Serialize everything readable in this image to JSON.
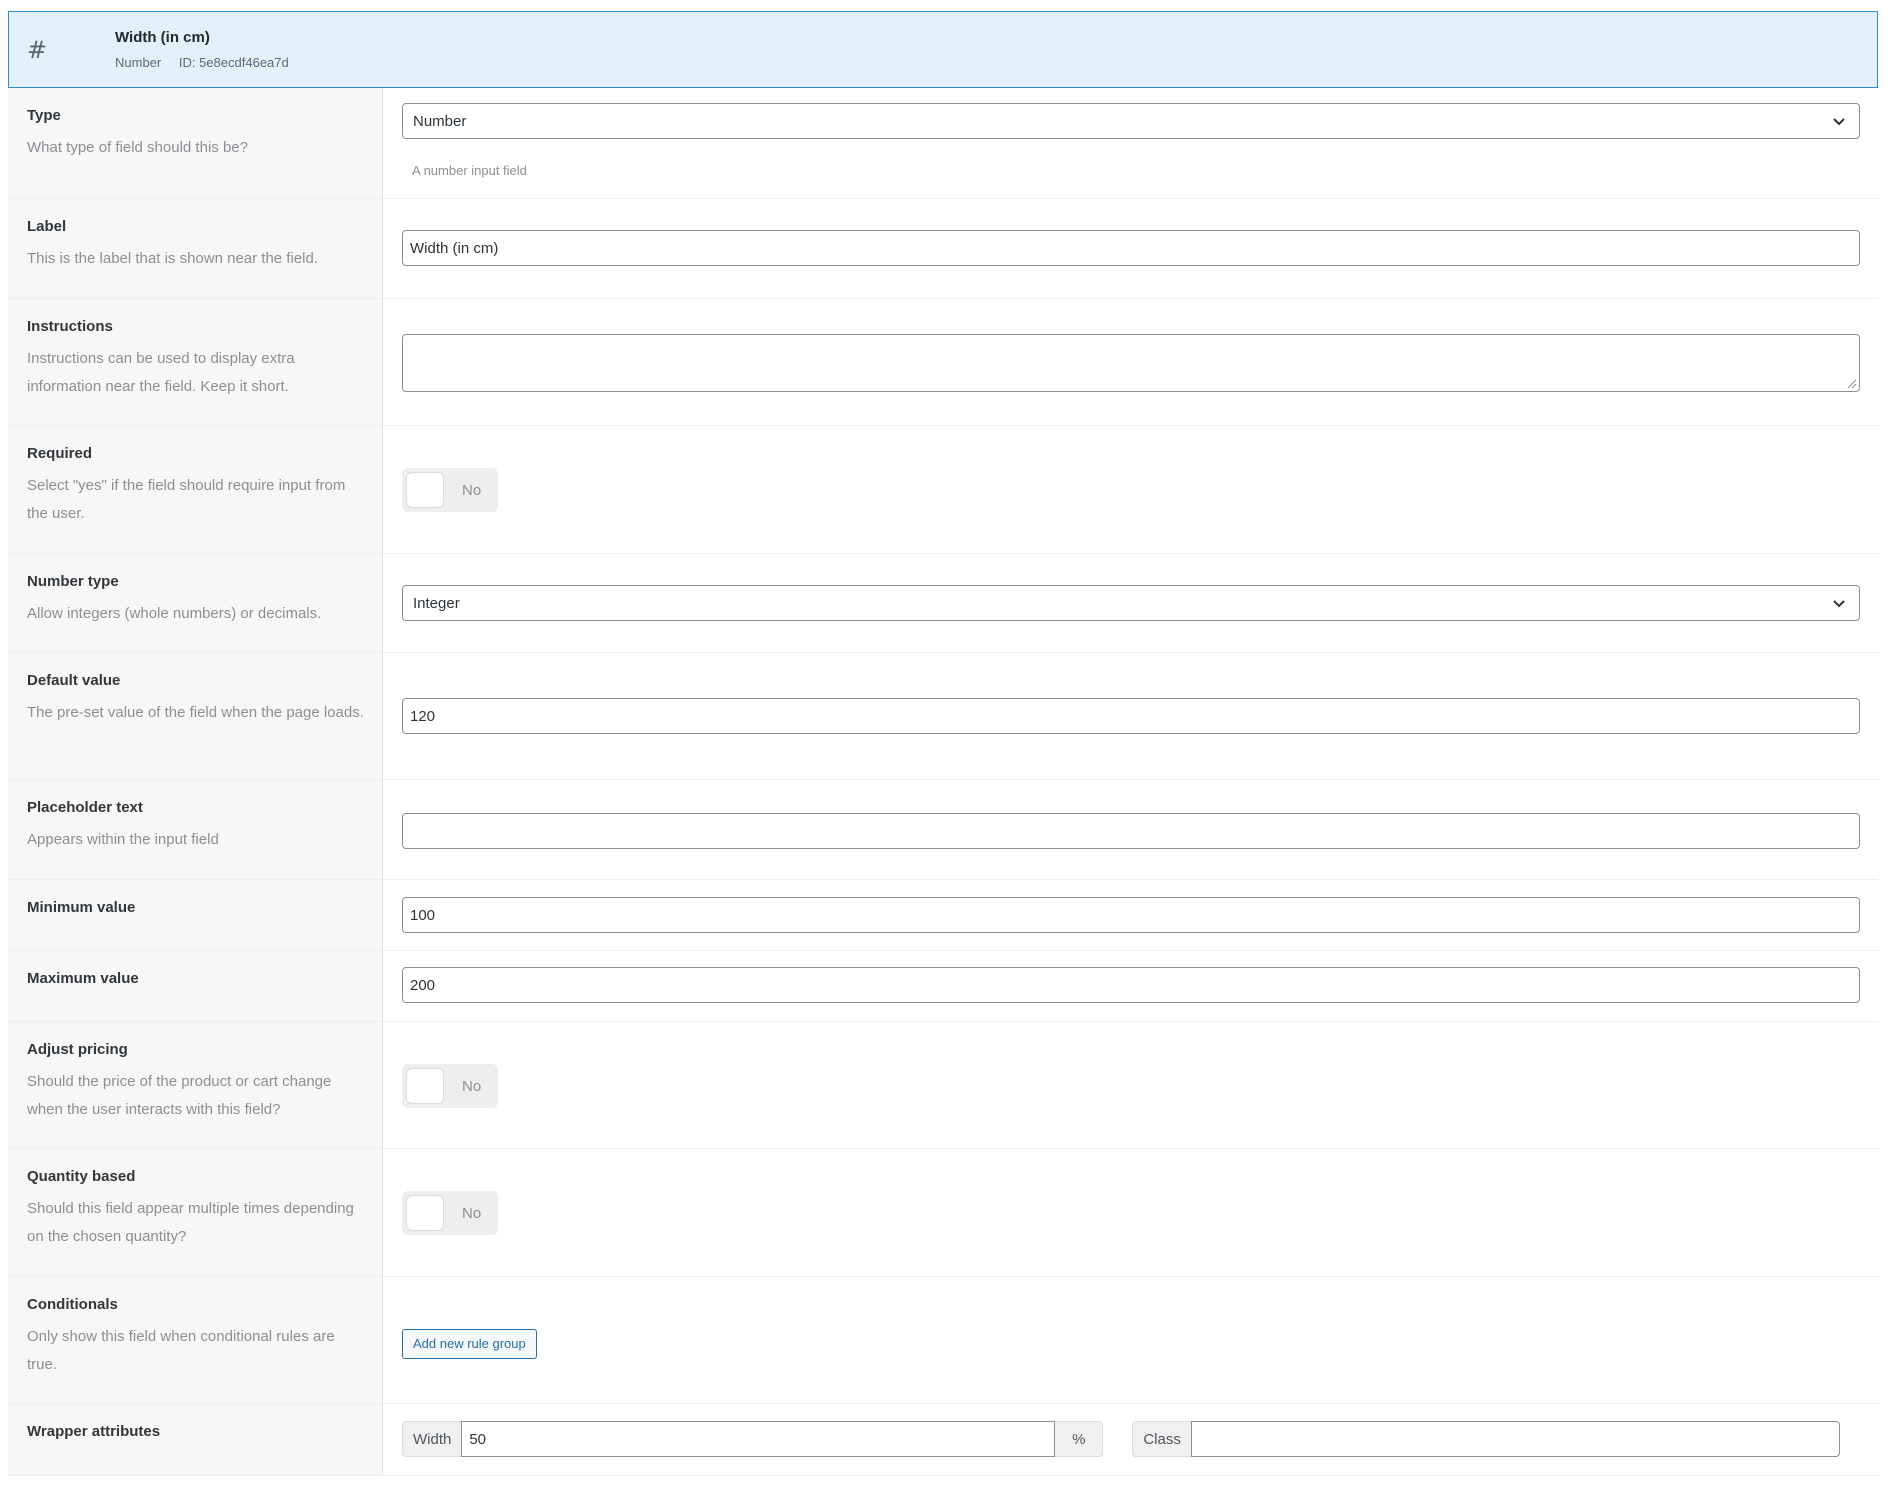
{
  "header": {
    "icon": "hash-icon",
    "title": "Width (in cm)",
    "type_label": "Number",
    "id_label": "ID: 5e8ecdf46ea7d"
  },
  "fields": {
    "type": {
      "label": "Type",
      "description": "What type of field should this be?",
      "value": "Number",
      "hint": "A number input field"
    },
    "label": {
      "label": "Label",
      "description": "This is the label that is shown near the field.",
      "value": "Width (in cm)"
    },
    "instructions": {
      "label": "Instructions",
      "description": "Instructions can be used to display extra information near the field. Keep it short.",
      "value": ""
    },
    "required": {
      "label": "Required",
      "description": "Select \"yes\" if the field should require input from the user.",
      "toggle": "No"
    },
    "number_type": {
      "label": "Number type",
      "description": "Allow integers (whole numbers) or decimals.",
      "value": "Integer"
    },
    "default_value": {
      "label": "Default value",
      "description": "The pre-set value of the field when the page loads.",
      "value": "120"
    },
    "placeholder": {
      "label": "Placeholder text",
      "description": "Appears within the input field",
      "value": ""
    },
    "min": {
      "label": "Minimum value",
      "value": "100"
    },
    "max": {
      "label": "Maximum value",
      "value": "200"
    },
    "adjust_pricing": {
      "label": "Adjust pricing",
      "description": "Should the price of the product or cart change when the user interacts with this field?",
      "toggle": "No"
    },
    "quantity_based": {
      "label": "Quantity based",
      "description": "Should this field appear multiple times depending on the chosen quantity?",
      "toggle": "No"
    },
    "conditionals": {
      "label": "Conditionals",
      "description": "Only show this field when conditional rules are true.",
      "button": "Add new rule group"
    },
    "wrapper": {
      "label": "Wrapper attributes",
      "width_label": "Width",
      "width_value": "50",
      "width_unit": "%",
      "class_label": "Class",
      "class_value": ""
    }
  },
  "colors": {
    "header_bg": "#e3eff9",
    "header_border": "#2e8ec9",
    "link_blue": "#2271b1"
  }
}
